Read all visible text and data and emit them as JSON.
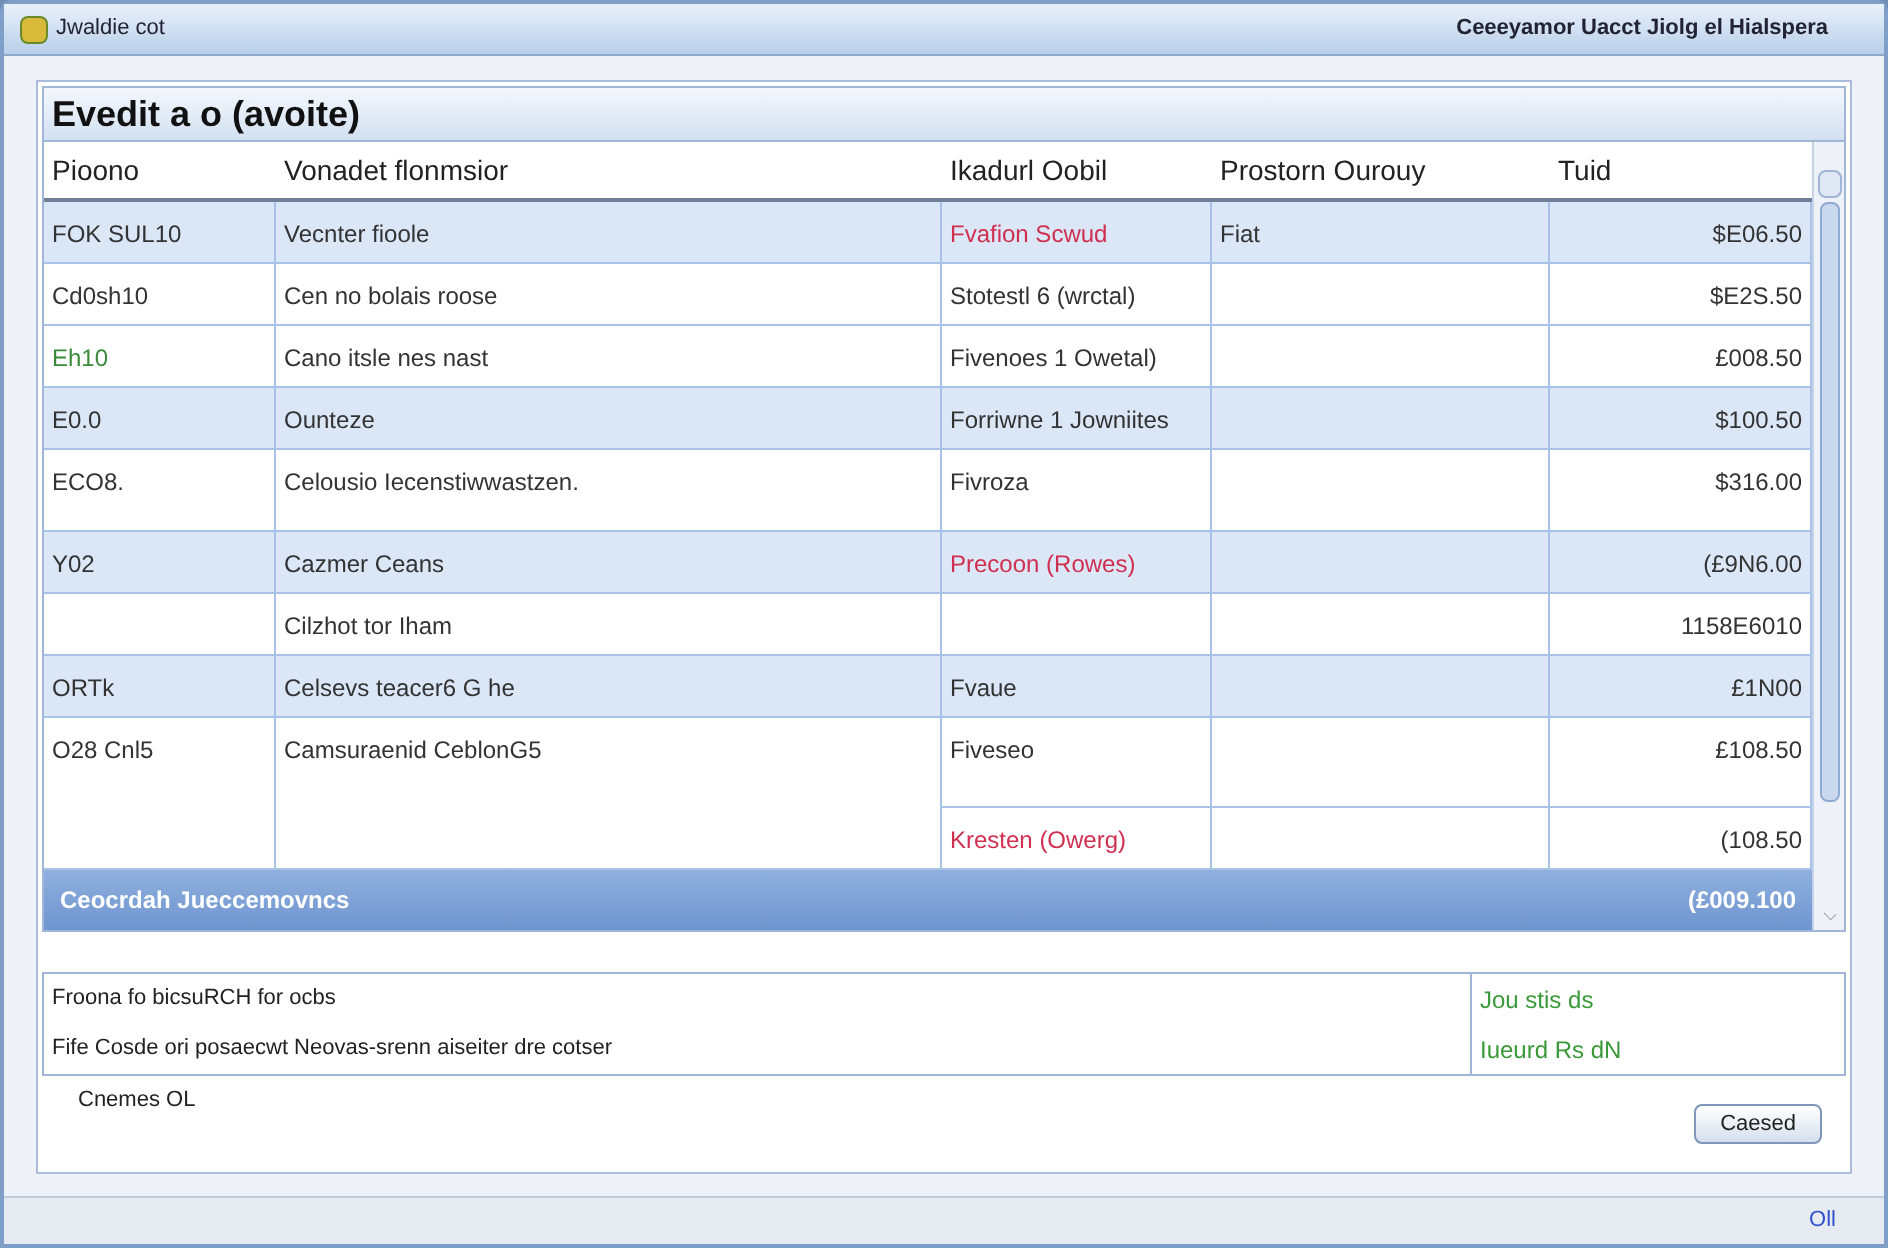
{
  "window": {
    "title": "Jwaldie cot",
    "subtitle": "Ceeeyamor Uacct Jiolg el Hialspera"
  },
  "group_title": "Evedit a o (avoite)",
  "table": {
    "columns": [
      "Pioono",
      "Vonadet flonmsior",
      "Ikadurl Oobil",
      "Prostorn Ourouy",
      "Tuid"
    ],
    "rows": [
      {
        "highlighted": true,
        "tall": false,
        "code": {
          "text": "FOK SUL10",
          "color": "#333333"
        },
        "description": "Vecnter fioole",
        "status": {
          "text": "Fvafion Scwud",
          "color": "#d03050"
        },
        "quantity": "Fiat",
        "total": "$E06.50"
      },
      {
        "highlighted": false,
        "tall": false,
        "code": {
          "text": "Cd0sh10",
          "color": "#333333"
        },
        "description": "Cen no bolais roose",
        "status": {
          "text": "Stotestl 6 (wrctal)",
          "color": "#333333"
        },
        "total": "$E2S.50"
      },
      {
        "highlighted": false,
        "tall": false,
        "code": {
          "text": "Eh10",
          "color": "#3a8a3a"
        },
        "description": "Cano itsle nes nast",
        "status": {
          "text": "Fivenoes 1 Owetal)",
          "color": "#333333"
        },
        "total": "£008.50"
      },
      {
        "highlighted": true,
        "tall": false,
        "code": {
          "text": "E0.0",
          "color": "#333333"
        },
        "description": "Ounteze",
        "status": {
          "text": "Forriwne 1 Jowniites",
          "color": "#333333"
        },
        "total": "$100.50"
      },
      {
        "highlighted": false,
        "tall": true,
        "code": {
          "text": "ECO8.",
          "color": "#333333"
        },
        "description": "Celousio Iecenstiwwastzen.",
        "status": {
          "text": "Fivroza",
          "color": "#333333"
        },
        "total": "$316.00"
      },
      {
        "highlighted": true,
        "tall": false,
        "code": {
          "text": "Y02",
          "color": "#333333"
        },
        "description": "Cazmer Ceans",
        "status": {
          "text": "Precoon (Rowes)",
          "color": "#d03050"
        },
        "total": "(£9N6.00"
      },
      {
        "highlighted": false,
        "tall": false,
        "description": "Cilzhot tor Iham",
        "total": "1158E6010"
      },
      {
        "highlighted": true,
        "tall": false,
        "code": {
          "text": "ORTk",
          "color": "#333333"
        },
        "description": "Celsevs teacer6 G he",
        "status": {
          "text": "Fvaue",
          "color": "#333333"
        },
        "total": "£1N00"
      },
      {
        "highlighted": false,
        "tall": false,
        "code": {
          "text": "O28 Cnl5",
          "color": "#333333"
        },
        "description": "Camsuraenid CeblonG5",
        "status": {
          "text": "Fiveseo",
          "color": "#333333"
        },
        "total": "£108.50",
        "extra": {
          "status": {
            "text": "Kresten (Owerg)",
            "color": "#d03050"
          },
          "total": "(108.50"
        }
      }
    ],
    "total_row": {
      "label": "Ceocrdah Jueccemovncs",
      "total": "(£009.100"
    }
  },
  "notes": {
    "lines": [
      "Froona fo bicsuRCH for ocbs",
      "Fife Cosde ori posaecwt Neovas-srenn aiseiter dre cotser"
    ],
    "side": [
      "Jou stis ds",
      "Iueurd Rs dN"
    ]
  },
  "caption": "Cnemes OL",
  "buttons": [
    "Caesed"
  ],
  "status_bar": "Oll"
}
